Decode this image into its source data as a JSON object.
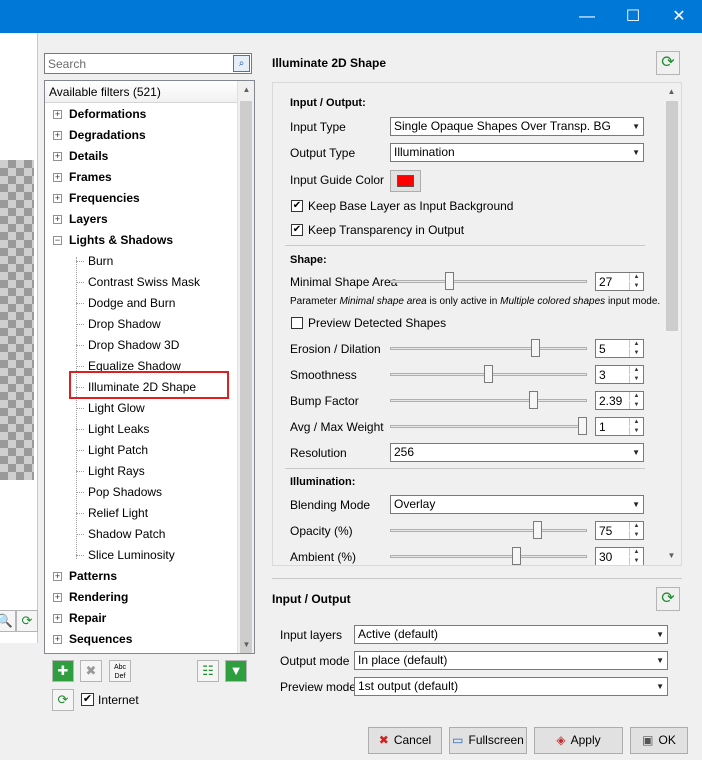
{
  "window": {
    "minimize": "—",
    "maximize": "☐",
    "close": "✕"
  },
  "search": {
    "placeholder": "Search"
  },
  "tree": {
    "header": "Available filters (521)",
    "categories_top": [
      "Deformations",
      "Degradations",
      "Details",
      "Frames",
      "Frequencies",
      "Layers"
    ],
    "expanded_category": "Lights & Shadows",
    "children": [
      "Burn",
      "Contrast Swiss Mask",
      "Dodge and Burn",
      "Drop Shadow",
      "Drop Shadow 3D",
      "Equalize Shadow",
      "Illuminate 2D Shape",
      "Light Glow",
      "Light Leaks",
      "Light Patch",
      "Light Rays",
      "Pop Shadows",
      "Relief Light",
      "Shadow Patch",
      "Slice Luminosity"
    ],
    "categories_bottom": [
      "Patterns",
      "Rendering",
      "Repair",
      "Sequences"
    ],
    "selected": "Illuminate 2D Shape"
  },
  "toolbar": {
    "internet_label": "Internet",
    "internet_checked": true,
    "abc_label": "Abc\nDef"
  },
  "filter": {
    "title": "Illuminate 2D Shape",
    "section_io": "Input / Output:",
    "input_type_label": "Input Type",
    "input_type_value": "Single Opaque Shapes Over Transp. BG",
    "output_type_label": "Output Type",
    "output_type_value": "Illumination",
    "guide_color_label": "Input Guide Color",
    "guide_color": "#ff0000",
    "keep_base_label": "Keep Base Layer as Input Background",
    "keep_transp_label": "Keep Transparency in Output",
    "section_shape": "Shape:",
    "min_area_label": "Minimal Shape Area",
    "min_area_value": "27",
    "note_pre": "Parameter ",
    "note_em1": "Minimal shape area",
    "note_mid": " is only active in ",
    "note_em2": "Multiple colored shapes",
    "note_post": " input mode.",
    "preview_label": "Preview Detected Shapes",
    "erosion_label": "Erosion / Dilation",
    "erosion_value": "5",
    "smooth_label": "Smoothness",
    "smooth_value": "3",
    "bump_label": "Bump Factor",
    "bump_value": "2.39",
    "avg_label": "Avg / Max Weight",
    "avg_value": "1",
    "res_label": "Resolution",
    "res_value": "256",
    "section_illum": "Illumination:",
    "blend_label": "Blending Mode",
    "blend_value": "Overlay",
    "opacity_label": "Opacity (%)",
    "opacity_value": "75",
    "ambient_label": "Ambient (%)",
    "ambient_value": "30",
    "sliders": {
      "min_area": 0.29,
      "erosion": 0.75,
      "smooth": 0.5,
      "bump": 0.74,
      "avg": 1.0,
      "opacity": 0.76,
      "ambient": 0.65
    }
  },
  "io": {
    "title": "Input / Output",
    "input_layers_label": "Input layers",
    "input_layers_value": "Active (default)",
    "output_mode_label": "Output mode",
    "output_mode_value": "In place (default)",
    "preview_mode_label": "Preview mode",
    "preview_mode_value": "1st output (default)"
  },
  "buttons": {
    "cancel": "Cancel",
    "fullscreen": "Fullscreen",
    "apply": "Apply",
    "ok": "OK"
  }
}
